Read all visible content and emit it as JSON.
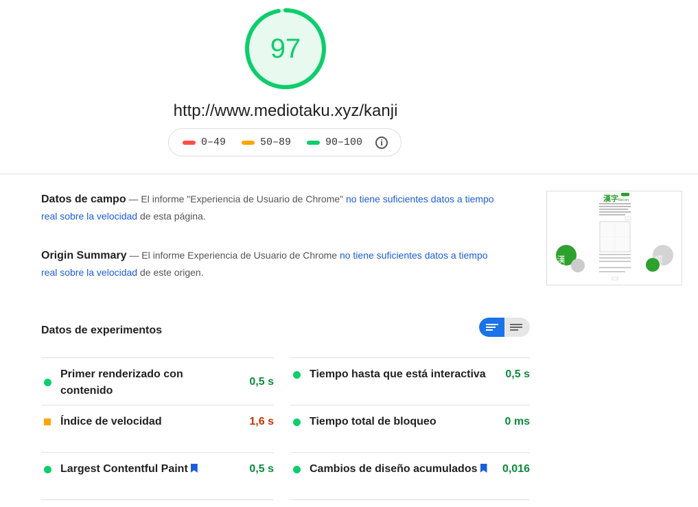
{
  "score": {
    "value": "97",
    "fraction": 0.97,
    "color": "#0cce6b"
  },
  "url": "http://www.mediotaku.xyz/kanji",
  "legend": {
    "items": [
      {
        "label": "0–49",
        "color": "#ff4e42"
      },
      {
        "label": "50–89",
        "color": "#ffa400"
      },
      {
        "label": "90–100",
        "color": "#0cce6b"
      }
    ],
    "info_icon": "info-icon"
  },
  "field_data": {
    "title": "Datos de campo",
    "prefix": " — El informe \"Experiencia de Usuario de Chrome\" ",
    "link": "no tiene suficientes datos a tiempo real sobre la velocidad",
    "suffix": " de esta página."
  },
  "origin_summary": {
    "title": "Origin Summary",
    "prefix": " — El informe Experiencia de Usuario de Chrome ",
    "link": "no tiene suficientes datos a tiempo real sobre la velocidad",
    "suffix": " de este origen."
  },
  "lab": {
    "title": "Datos de experimentos",
    "metrics": [
      {
        "label": "Primer renderizado con contenido",
        "value": "0,5 s",
        "status": "pass"
      },
      {
        "label": "Tiempo hasta que está interactiva",
        "value": "0,5 s",
        "status": "pass"
      },
      {
        "label": "Índice de velocidad",
        "value": "1,6 s",
        "status": "average"
      },
      {
        "label": "Tiempo total de bloqueo",
        "value": "0 ms",
        "status": "pass"
      },
      {
        "label": "Largest Contentful Paint",
        "value": "0,5 s",
        "status": "pass"
      },
      {
        "label": "Cambios de diseño acumulados",
        "value": "0,016",
        "status": "pass"
      }
    ]
  },
  "thumbnail": {
    "logo": "漢字",
    "logo_sub": "Recon",
    "left_badge": "漢字",
    "right_badge": "認識"
  },
  "colors": {
    "pass": "#0cce6b",
    "average": "#ffa400",
    "fail": "#ff4e42",
    "pass_text": "#0a8a3a",
    "average_text": "#c33300",
    "link": "#1a5ddc",
    "toggle": "#1a73e8"
  }
}
